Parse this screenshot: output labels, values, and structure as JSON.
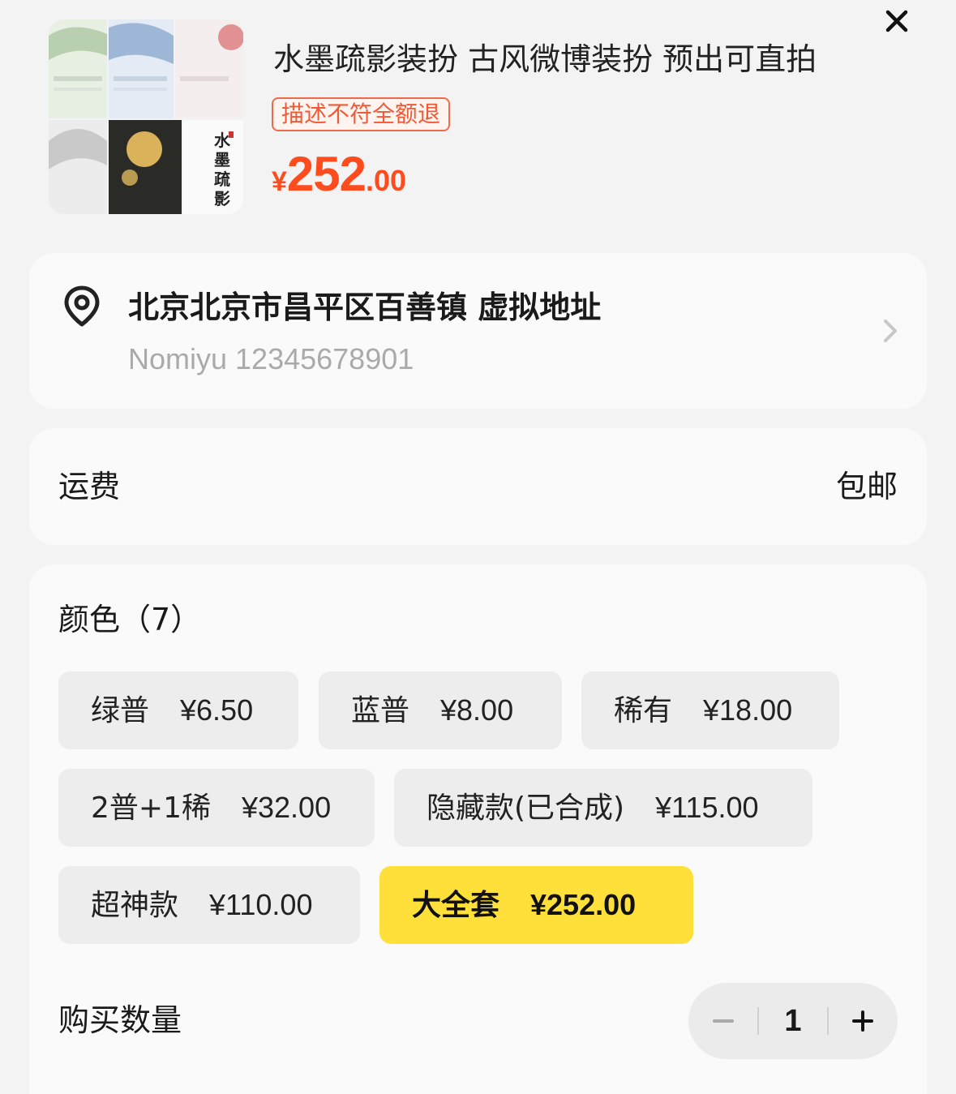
{
  "product": {
    "title": "水墨疏影装扮 古风微博装扮 预出可直拍",
    "tag": "描述不符全额退",
    "price_currency": "¥",
    "price_integer": "252",
    "price_decimal": ".00",
    "thumb_caption": [
      "水",
      "墨",
      "疏",
      "影"
    ]
  },
  "address": {
    "line": "北京北京市昌平区百善镇 虚拟地址",
    "contact": "Nomiyu 12345678901"
  },
  "shipping": {
    "label": "运费",
    "value": "包邮"
  },
  "spec": {
    "title": "颜色（7）",
    "options": [
      {
        "name": "绿普",
        "price": "¥6.50",
        "selected": false
      },
      {
        "name": "蓝普",
        "price": "¥8.00",
        "selected": false
      },
      {
        "name": "稀有",
        "price": "¥18.00",
        "selected": false
      },
      {
        "name": "2普+1稀",
        "price": "¥32.00",
        "selected": false
      },
      {
        "name": "隐藏款(已合成)",
        "price": "¥115.00",
        "selected": false
      },
      {
        "name": "超神款",
        "price": "¥110.00",
        "selected": false
      },
      {
        "name": "大全套",
        "price": "¥252.00",
        "selected": true
      }
    ]
  },
  "quantity": {
    "label": "购买数量",
    "value": "1"
  },
  "colors": {
    "accent": "#ff4c1e",
    "selected": "#ffe03a",
    "tag_border": "#ef6a4a"
  },
  "icons": [
    "close-icon",
    "location-pin-icon",
    "chevron-right-icon",
    "minus-icon",
    "plus-icon"
  ]
}
